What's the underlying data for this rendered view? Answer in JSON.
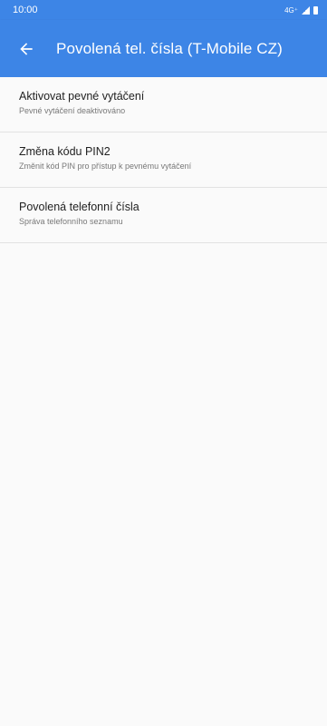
{
  "status_bar": {
    "time": "10:00",
    "network": "4G⁺"
  },
  "app_bar": {
    "title": "Povolená tel. čísla (T-Mobile CZ)"
  },
  "list": {
    "items": [
      {
        "title": "Aktivovat pevné vytáčení",
        "subtitle": "Pevné vytáčení deaktivováno"
      },
      {
        "title": "Změna kódu PIN2",
        "subtitle": "Změnit kód PIN pro přístup k pevnému vytáčení"
      },
      {
        "title": "Povolená telefonní čísla",
        "subtitle": "Správa telefonního seznamu"
      }
    ]
  },
  "colors": {
    "primary": "#3d85e6",
    "background": "#fafafa",
    "divider": "#e2e2e2"
  }
}
